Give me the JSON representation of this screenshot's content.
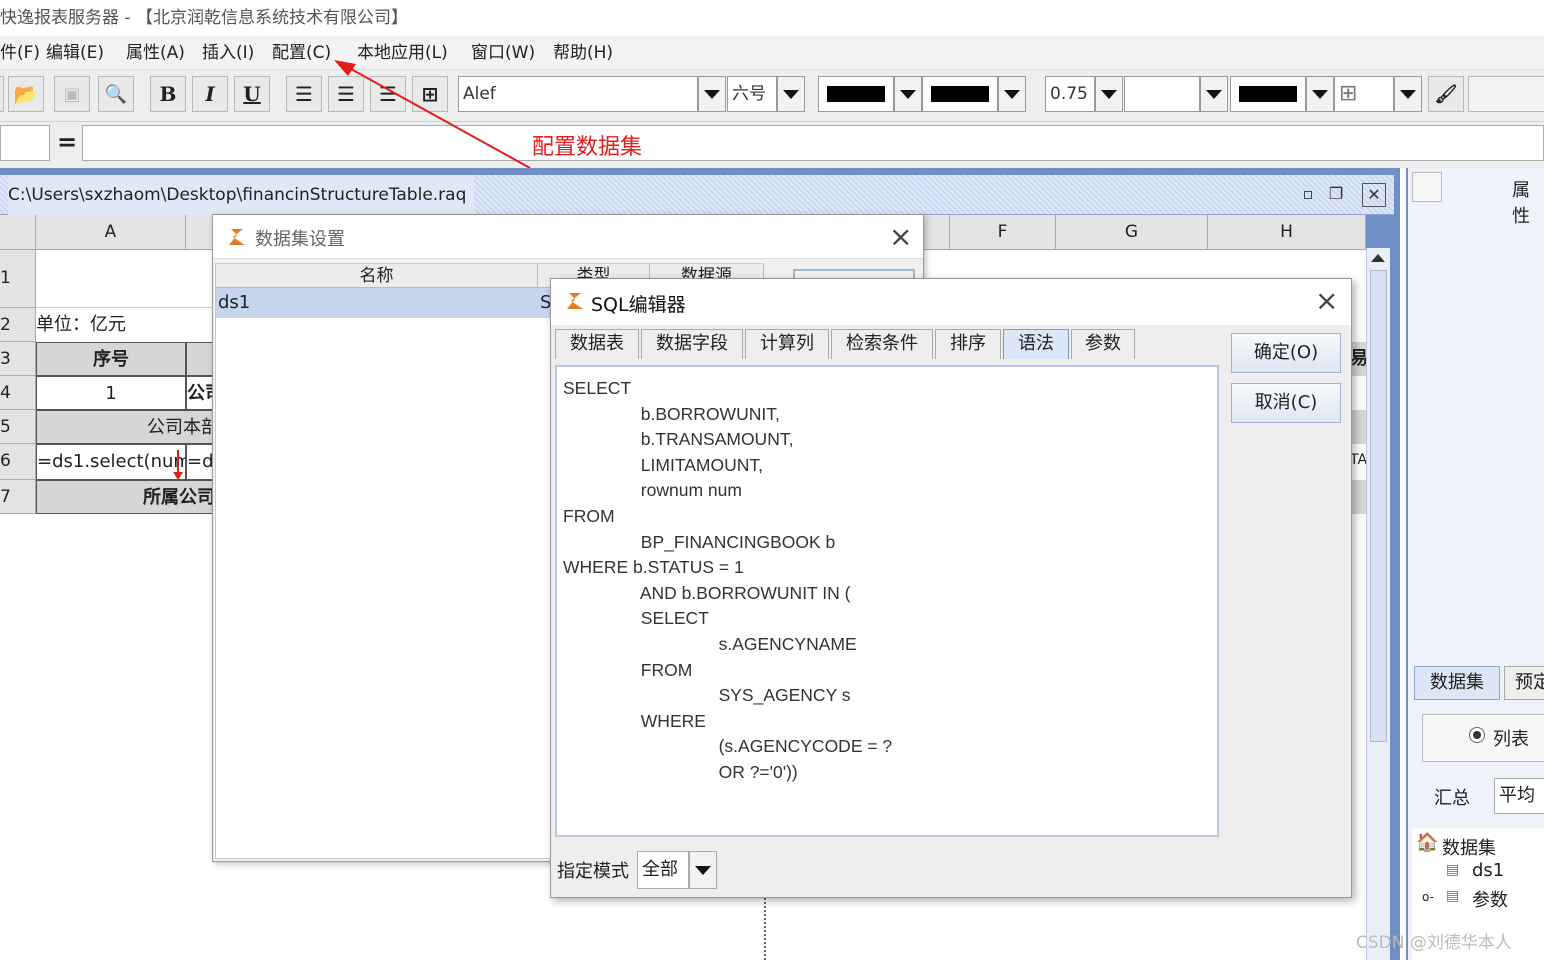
{
  "app": {
    "title": "快逸报表服务器 - 【北京润乾信息系统技术有限公司】"
  },
  "menu": [
    "件(F)",
    "编辑(E)",
    "属性(A)",
    "插入(I)",
    "配置(C)",
    "本地应用(L)",
    "窗口(W)",
    "帮助(H)"
  ],
  "toolbar": {
    "bold": "B",
    "italic": "I",
    "underline": "U",
    "font": "Alef",
    "font_size": "六号",
    "line_width": "0.75"
  },
  "formula": {
    "eq": "="
  },
  "annotation": {
    "callout": "配置数据集",
    "color": "#e31c1c"
  },
  "document": {
    "path": "C:\\Users\\sxzhaom\\Desktop\\financinStructureTable.raq"
  },
  "sheet": {
    "columns": [
      "A",
      "F",
      "G",
      "H"
    ],
    "rows": [
      "1",
      "2",
      "3",
      "4",
      "5",
      "6",
      "7"
    ],
    "cells": {
      "unit": "单位：亿元",
      "seq_header": "序号",
      "seq_1": "1",
      "company_partial": "公司",
      "company_hq": "公司本部",
      "formula_a6": "=ds1.select(num)",
      "formula_b6": "=ds",
      "subsidiary": "所属公司",
      "right_partial_1": "易",
      "right_partial_2": "TA"
    }
  },
  "dataset_dialog": {
    "title": "数据集设置",
    "headers": [
      "名称",
      "类型",
      "数据源"
    ],
    "row": {
      "name": "ds1",
      "type": "S"
    }
  },
  "sql_dialog": {
    "title": "SQL编辑器",
    "tabs": [
      "数据表",
      "数据字段",
      "计算列",
      "检索条件",
      "排序",
      "语法",
      "参数"
    ],
    "active_tab": "语法",
    "sql": "SELECT\n                b.BORROWUNIT,\n                b.TRANSAMOUNT,\n                LIMITAMOUNT,\n                rownum num\nFROM\n                BP_FINANCINGBOOK b\nWHERE b.STATUS = 1\n                AND b.BORROWUNIT IN (\n                SELECT\n                                s.AGENCYNAME\n                FROM\n                                SYS_AGENCY s\n                WHERE\n                                (s.AGENCYCODE = ?\n                                OR ?='0'))",
    "ok": "确定(O)",
    "cancel": "取消(C)",
    "mode_label": "指定模式",
    "mode_value": "全部"
  },
  "right_panel": {
    "header": "属性",
    "tabs": [
      "数据集",
      "预定"
    ],
    "radio": "列表",
    "summary_label": "汇总",
    "summary_value": "平均",
    "tree": {
      "root": "数据集",
      "children": [
        "ds1",
        "参数"
      ]
    }
  },
  "watermark": "CSDN @刘德华本人"
}
